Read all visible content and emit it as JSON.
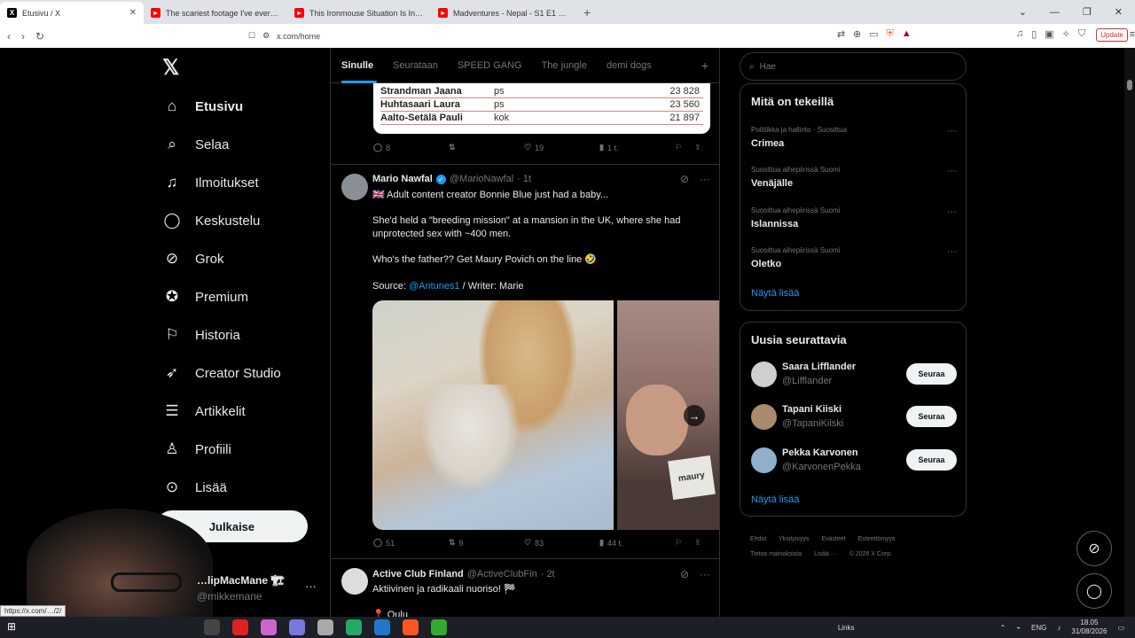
{
  "browser": {
    "tabs": [
      {
        "title": "Etusivu / X",
        "active": true
      },
      {
        "title": "The scariest footage I've ever seen…",
        "active": false
      },
      {
        "title": "This Ironmouse Situation Is Insane -…",
        "active": false
      },
      {
        "title": "Madventures - Nepal - S1 E1 - YouTu…",
        "active": false
      }
    ],
    "url": "x.com/home",
    "update_label": "Update"
  },
  "sidebar": {
    "items": [
      {
        "label": "Etusivu",
        "icon": "home-icon"
      },
      {
        "label": "Selaa",
        "icon": "search-icon"
      },
      {
        "label": "Ilmoitukset",
        "icon": "bell-icon"
      },
      {
        "label": "Keskustelu",
        "icon": "chat-icon"
      },
      {
        "label": "Grok",
        "icon": "grok-icon"
      },
      {
        "label": "Premium",
        "icon": "verified-icon"
      },
      {
        "label": "Historia",
        "icon": "bookmark-icon"
      },
      {
        "label": "Creator Studio",
        "icon": "rocket-icon"
      },
      {
        "label": "Artikkelit",
        "icon": "article-icon"
      },
      {
        "label": "Profiili",
        "icon": "person-icon"
      },
      {
        "label": "Lisää",
        "icon": "more-circle-icon"
      }
    ],
    "post_label": "Julkaise",
    "account": {
      "name": "…lipMacMane 🏗",
      "handle": "@mikkemane"
    }
  },
  "feed": {
    "tabs": [
      "Sinulle",
      "Seurataan",
      "SPEED GANG",
      "The jungle",
      "demi dogs"
    ],
    "results_table": [
      {
        "name": "Strandman Jaana",
        "party": "ps",
        "votes": "23 828"
      },
      {
        "name": "Huhtasaari Laura",
        "party": "ps",
        "votes": "23 560"
      },
      {
        "name": "Aalto-Setälä Pauli",
        "party": "kok",
        "votes": "21 897"
      }
    ],
    "prev_actions": {
      "replies": "8",
      "reposts": "",
      "likes": "19",
      "views": "1 t."
    },
    "tweet1": {
      "name": "Mario Nawfal",
      "handle": "@MarioNawfal",
      "time": "· 1t",
      "line1": "🇬🇧 Adult content creator Bonnie Blue just had a baby...",
      "line2": "She'd held a \"breeding mission\" at a mansion in the UK, where she had unprotected sex with ~400 men.",
      "line3": "Who's the father?? Get Maury Povich on the line 🤣",
      "source_prefix": "Source: ",
      "source_link": "@Antunes1",
      "source_suffix": " / Writer: Marie",
      "card_text": "maury",
      "actions": {
        "replies": "51",
        "reposts": "9",
        "likes": "83",
        "views": "44 t."
      }
    },
    "tweet2": {
      "name": "Active Club Finland",
      "handle": "@ActiveClubFin",
      "time": "· 2t",
      "line1": "Aktiivinen ja radikaali nuoriso! 🏁",
      "line2": "📍 Oulu"
    }
  },
  "right": {
    "search_placeholder": "Hae",
    "trends_title": "Mitä on tekeillä",
    "trends": [
      {
        "meta": "Politiikka ja hallinto · Suosittua",
        "topic": "Crimea"
      },
      {
        "meta": "Suosittua aihepiirissä Suomi",
        "topic": "Venäjälle"
      },
      {
        "meta": "Suosittua aihepiirissä Suomi",
        "topic": "Islannissa"
      },
      {
        "meta": "Suosittua aihepiirissä Suomi",
        "topic": "Oletko"
      }
    ],
    "show_more": "Näytä lisää",
    "who_title": "Uusia seurattavia",
    "who": [
      {
        "name": "Saara Lifflander",
        "handle": "@Lifflander"
      },
      {
        "name": "Tapani Kiiski",
        "handle": "@TapaniKiiski"
      },
      {
        "name": "Pekka Karvonen",
        "handle": "@KarvonenPekka"
      }
    ],
    "follow_label": "Seuraa",
    "footer": [
      "Ehdot",
      "Yksityisyys",
      "Evästeet",
      "Esteettömyys",
      "Tietoa mainoksista",
      "Lisää ···",
      "© 2026 X Corp."
    ]
  },
  "taskbar": {
    "links_label": "Links",
    "lang": "ENG",
    "time": "18.05",
    "date": "31/08/2026"
  },
  "status_url": "https://x.com/…/2/"
}
